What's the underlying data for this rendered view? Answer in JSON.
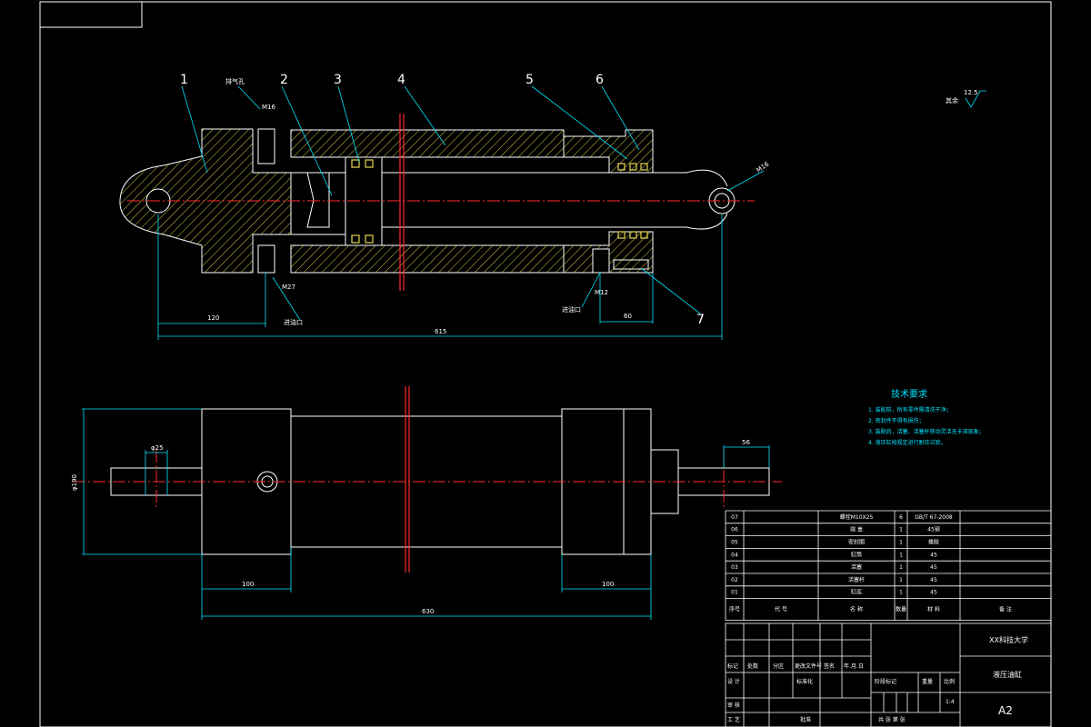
{
  "balloons": [
    "1",
    "2",
    "3",
    "4",
    "5",
    "6",
    "7"
  ],
  "section_labels": {
    "exhaust": "排气孔",
    "oil_port_left": "进油口",
    "oil_port_right": "进油口",
    "thread_top": "M16",
    "thread_bottom_left": "M27",
    "thread_bottom_right": "M12",
    "thread_eye": "M16",
    "roughness_text": "其余",
    "roughness_value": "12.5"
  },
  "dimensions": {
    "d120": "120",
    "d615": "615",
    "d60": "60",
    "d25": "φ25",
    "d56": "56",
    "d100_left": "100",
    "d100_right": "100",
    "d630": "630",
    "d190": "φ190"
  },
  "tech_requirements": {
    "title": "技术要求",
    "lines": [
      "1. 装配前，所有零件需清洗干净；",
      "2. 密封件不得有损伤；",
      "3. 装配后，活塞、活塞杆移动灵活无卡滞现象；",
      "4. 液压缸按规定进行耐压试验。"
    ]
  },
  "parts_list": [
    {
      "no": "07",
      "code": "",
      "name": "螺栓M10X25",
      "qty": "6",
      "material": "GB/T 67-2008",
      "note": ""
    },
    {
      "no": "06",
      "code": "",
      "name": "端 盖",
      "qty": "1",
      "material": "45钢",
      "note": ""
    },
    {
      "no": "05",
      "code": "",
      "name": "密封圈",
      "qty": "1",
      "material": "橡胶",
      "note": ""
    },
    {
      "no": "04",
      "code": "",
      "name": "缸筒",
      "qty": "1",
      "material": "45",
      "note": ""
    },
    {
      "no": "03",
      "code": "",
      "name": "活塞",
      "qty": "1",
      "material": "45",
      "note": ""
    },
    {
      "no": "02",
      "code": "",
      "name": "活塞杆",
      "qty": "1",
      "material": "45",
      "note": ""
    },
    {
      "no": "01",
      "code": "",
      "name": "缸底",
      "qty": "1",
      "material": "45",
      "note": ""
    }
  ],
  "parts_header": {
    "no": "序号",
    "code": "代 号",
    "name": "名 称",
    "qty": "数量",
    "material": "材 料",
    "note": "备 注"
  },
  "title_block": {
    "school": "XX科技大学",
    "drawing_name": "液压油缸",
    "sheet_size": "A2",
    "scale": "1:4",
    "row_labels": [
      "标记",
      "处数",
      "分区",
      "更改文件号",
      "签名",
      "年.月.日"
    ],
    "design": "设 计",
    "standard": "标准化",
    "stage": "阶段标记",
    "weight": "重量",
    "ratio": "比例",
    "review": "审 核",
    "process": "工 艺",
    "approve": "批准",
    "sheets": "共  张  第  张"
  }
}
